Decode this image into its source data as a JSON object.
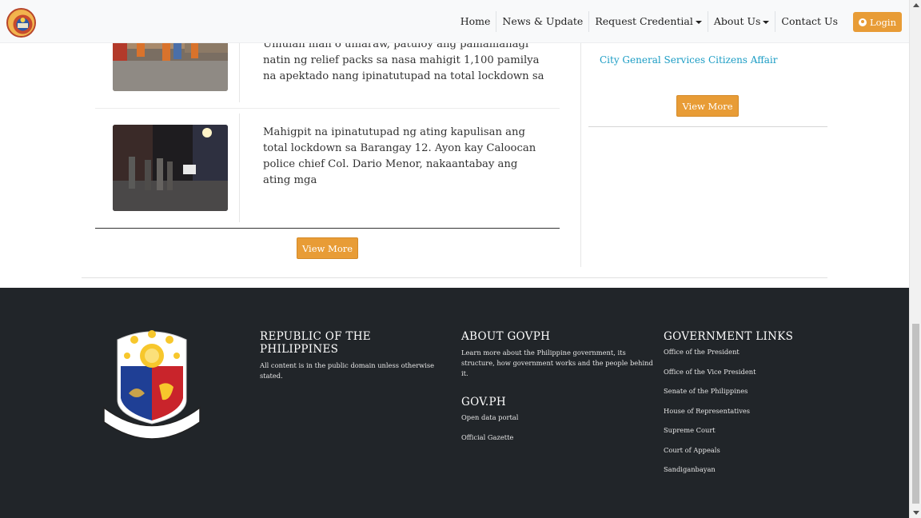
{
  "nav": {
    "items": [
      {
        "label": "Home",
        "dropdown": false
      },
      {
        "label": "News & Update",
        "dropdown": false
      },
      {
        "label": "Request Credential",
        "dropdown": true
      },
      {
        "label": "About Us",
        "dropdown": true
      },
      {
        "label": "Contact Us",
        "dropdown": false
      }
    ],
    "login_label": "Login"
  },
  "news": {
    "items": [
      {
        "text": "Umulan man o umaraw, patuloy ang pamamahagi natin ng relief packs sa nasa mahigit 1,100 pamilya na apektado nang ipinatutupad na total lockdown sa"
      },
      {
        "text": "Mahigpit na ipinatutupad ng ating kapulisan ang total lockdown sa Barangay 12. Ayon kay Caloocan police chief Col. Dario Menor, nakaantabay ang ating mga"
      }
    ],
    "view_more_label": "View More"
  },
  "sidebar": {
    "link": "City General Services Citizens Affair",
    "view_more_label": "View More"
  },
  "footer": {
    "seal_text": "REPUBLIKA NG PILIPINAS",
    "republic": {
      "title": "REPUBLIC OF THE PHILIPPINES",
      "text": "All content is in the public domain unless otherwise stated."
    },
    "about": {
      "title": "ABOUT GOVPH",
      "text": "Learn more about the Philippine government, its structure, how government works and the people behind it."
    },
    "govph": {
      "title": "GOV.PH",
      "links": [
        "Open data portal",
        "Official Gazette"
      ]
    },
    "gov_links": {
      "title": "GOVERNMENT LINKS",
      "links": [
        "Office of the President",
        "Office of the Vice President",
        "Senate of the Philippines",
        "House of Representatives",
        "Supreme Court",
        "Court of Appeals",
        "Sandiganbayan"
      ]
    }
  },
  "colors": {
    "accent": "#e89c36",
    "link": "#1a9cc4",
    "footer_bg": "#212529"
  }
}
